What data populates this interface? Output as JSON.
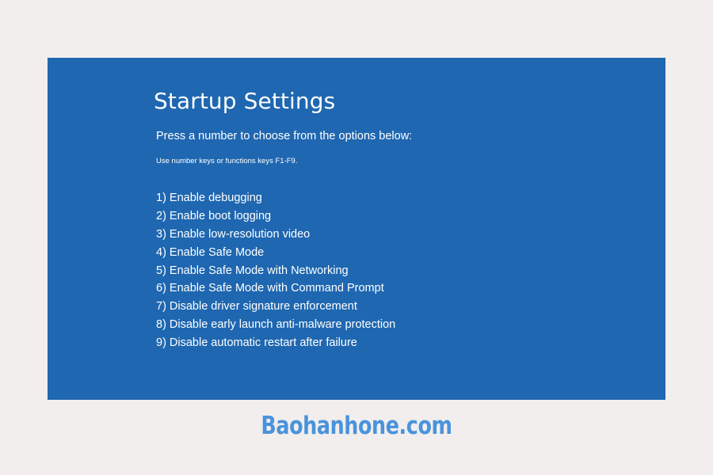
{
  "screen": {
    "title": "Startup Settings",
    "prompt": "Press a number to choose from the options below:",
    "hint": "Use number keys or functions keys F1-F9.",
    "options": [
      "1) Enable debugging",
      "2) Enable boot logging",
      "3) Enable low-resolution video",
      "4) Enable Safe Mode",
      "5) Enable Safe Mode with Networking",
      "6) Enable Safe Mode with Command Prompt",
      "7) Disable driver signature enforcement",
      "8) Disable early launch anti-malware protection",
      "9) Disable automatic restart after failure"
    ]
  },
  "watermark": "Baohanhone.com",
  "colors": {
    "page_background": "#f1eeed",
    "screen_background": "#1f67b1",
    "text": "#ffffff",
    "watermark": "#4a93dc"
  }
}
